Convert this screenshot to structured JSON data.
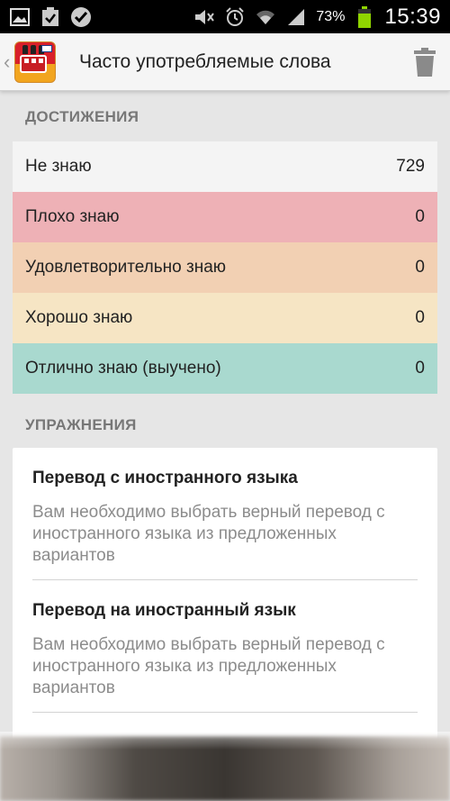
{
  "status_bar": {
    "battery_percent": "73%",
    "time": "15:39",
    "left_icons": [
      "gallery-icon",
      "task-check-icon",
      "check-badge-icon"
    ],
    "right_icons": [
      "mute-icon",
      "alarm-icon",
      "wifi-icon",
      "signal-icon",
      "battery-icon"
    ]
  },
  "action_bar": {
    "title": "Часто употребляемые слова",
    "up_caret": "‹"
  },
  "achievements": {
    "header": "ДОСТИЖЕНИЯ",
    "rows": [
      {
        "label": "Не знаю",
        "value": "729",
        "color": "#f4f4f4"
      },
      {
        "label": "Плохо знаю",
        "value": "0",
        "color": "#eeb1b6"
      },
      {
        "label": "Удовлетворительно знаю",
        "value": "0",
        "color": "#f2d0b3"
      },
      {
        "label": "Хорошо знаю",
        "value": "0",
        "color": "#f6e5c4"
      },
      {
        "label": "Отлично знаю (выучено)",
        "value": "0",
        "color": "#a9d9cf"
      }
    ]
  },
  "exercises": {
    "header": "УПРАЖНЕНИЯ",
    "items": [
      {
        "title": "Перевод с иностранного языка",
        "description": "Вам необходимо выбрать верный перевод с иностранного языка из предложенных вариантов"
      },
      {
        "title": "Перевод на иностранный язык",
        "description": "Вам необходимо выбрать верный перевод с иностранного языка из предложенных вариантов"
      }
    ]
  }
}
